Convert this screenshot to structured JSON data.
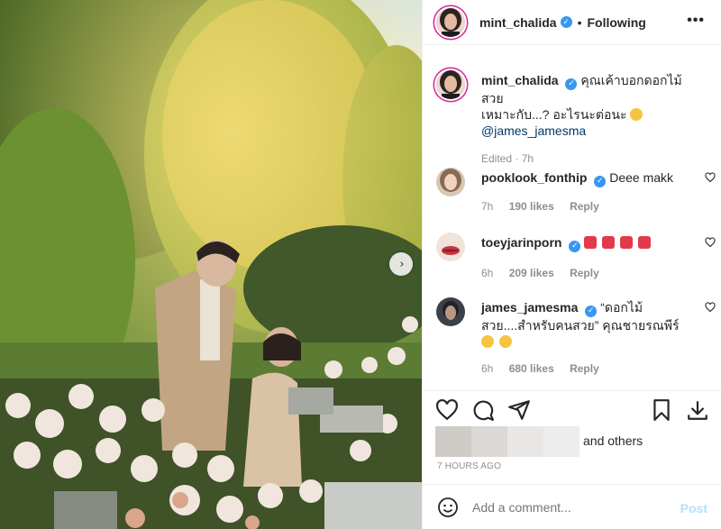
{
  "header": {
    "username": "mint_chalida",
    "separator": "•",
    "follow_status": "Following",
    "more_label": "•••"
  },
  "caption": {
    "username": "mint_chalida",
    "text_line1": "คุณเค้าบอกดอกไม้สวย",
    "text_line2": "เหมาะกับ...? อะไรนะต่อนะ",
    "mention": "@james_jamesma",
    "edited": "Edited · 7h"
  },
  "comments": [
    {
      "username": "pooklook_fonthip",
      "text": "Deee makk",
      "time": "7h",
      "likes": "190 likes",
      "reply": "Reply"
    },
    {
      "username": "toeyjarinporn",
      "text": "",
      "time": "6h",
      "likes": "209 likes",
      "reply": "Reply"
    },
    {
      "username": "james_jamesma",
      "text": "“ดอกไม้",
      "text2": "สวย....สำหรับคนสวย” คุณชายรณพีร์",
      "time": "6h",
      "likes": "680 likes",
      "reply": "Reply"
    }
  ],
  "likes_summary": "and others",
  "timestamp": "7 HOURS AGO",
  "composer": {
    "placeholder": "Add a comment...",
    "post_label": "Post"
  },
  "icons": {
    "verified": "verified-badge-icon",
    "like": "heart-icon",
    "comment": "comment-icon",
    "share": "share-icon",
    "save": "bookmark-icon",
    "download": "download-icon",
    "emoji": "emoji-icon",
    "next": "chevron-right-icon"
  },
  "colors": {
    "accent": "#3897f0",
    "post_disabled": "#b2dffc",
    "meta": "#8e8e8e"
  }
}
